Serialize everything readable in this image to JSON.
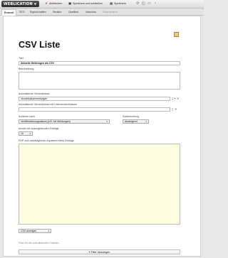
{
  "app": {
    "logo": "WEBLICATION",
    "logo_arrow": "▼"
  },
  "toolbar": {
    "abort_label": "Abbrechen",
    "save_close_label": "Speichern und schließen",
    "save_label": "Speichern"
  },
  "tabs": [
    {
      "label": "Entwurf",
      "active": true
    },
    {
      "label": "SEO"
    },
    {
      "label": "Eigenschaften"
    },
    {
      "label": "Struktur"
    },
    {
      "label": "Quelltext"
    },
    {
      "label": "Vorschau"
    },
    {
      "label": "Sofortansicht",
      "disabled": true
    }
  ],
  "page": {
    "title": "CSV Liste"
  },
  "form": {
    "title_label": "Titel",
    "title_value": "Aktuelle Meldungen als CSV",
    "description_label": "Beschreibung",
    "dirs_label": "Aufzulistende Verzeichnisse",
    "dirs_value": "/dorakbukka/meldungen",
    "dirs_sub_label": "Aufzulistende Verzeichnisse mit Unterverzeichnissen",
    "sort_label": "Sortieren nach",
    "sort_value": "Veröffentlichungsdatum (z.B. bei Meldungen)",
    "sort_dir_label": "Sortierrichtung",
    "sort_dir_value": "Absteigend",
    "count_label": "Anzahl der auszugebenden Einträge",
    "count_value": "10",
    "php_label": "PHP zum nachträglichen Anpassen eines Eintrags",
    "display_value": "CSV anzeigen"
  },
  "filter": {
    "heading": "Filter für die aufzulistenden Dateien",
    "add_label": "Filter hinzufügen"
  }
}
